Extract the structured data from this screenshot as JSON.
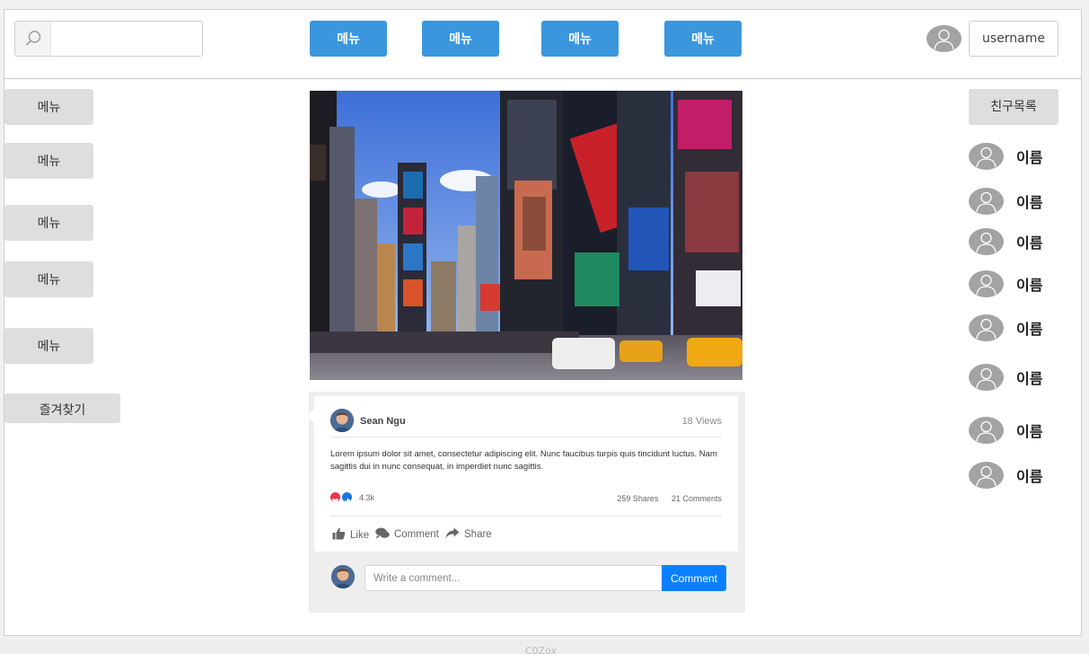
{
  "header": {
    "search": {
      "value": "",
      "placeholder": ""
    },
    "nav": [
      "메뉴",
      "메뉴",
      "메뉴",
      "메뉴"
    ],
    "username": "username"
  },
  "sidebar": {
    "items": [
      "메뉴",
      "메뉴",
      "메뉴",
      "메뉴",
      "메뉴"
    ],
    "favorites": "즐겨찾기"
  },
  "post": {
    "author": "Sean Ngu",
    "views": "18 Views",
    "body": "Lorem ipsum dolor sit amet, consectetur adipiscing elit. Nunc faucibus turpis quis tincidunt luctus. Nam sagittis dui in nunc consequat, in imperdiet nunc sagittis.",
    "reactions_count": "4.3k",
    "shares": "259 Shares",
    "comments": "21 Comments",
    "actions": {
      "like": "Like",
      "comment": "Comment",
      "share": "Share"
    },
    "comment_input": {
      "value": "",
      "placeholder": "Write a comment..."
    },
    "comment_button": "Comment"
  },
  "friends": {
    "title": "친구목록",
    "names": [
      "이름",
      "이름",
      "이름",
      "이름",
      "이름",
      "이름",
      "이름",
      "이름"
    ]
  },
  "footer": {
    "text": "C0Zox"
  },
  "colors": {
    "nav_button": "#3a96dd",
    "side_button": "#dedede",
    "avatar": "#a3a3a3",
    "comment_button": "#0a80ff"
  },
  "icons": {
    "search": "search-icon",
    "avatar": "user-avatar-icon",
    "like": "thumbs-up-icon",
    "comment": "comment-bubble-icon",
    "share": "share-arrow-icon",
    "love": "heart-reaction-icon",
    "like_reaction": "like-reaction-icon"
  }
}
